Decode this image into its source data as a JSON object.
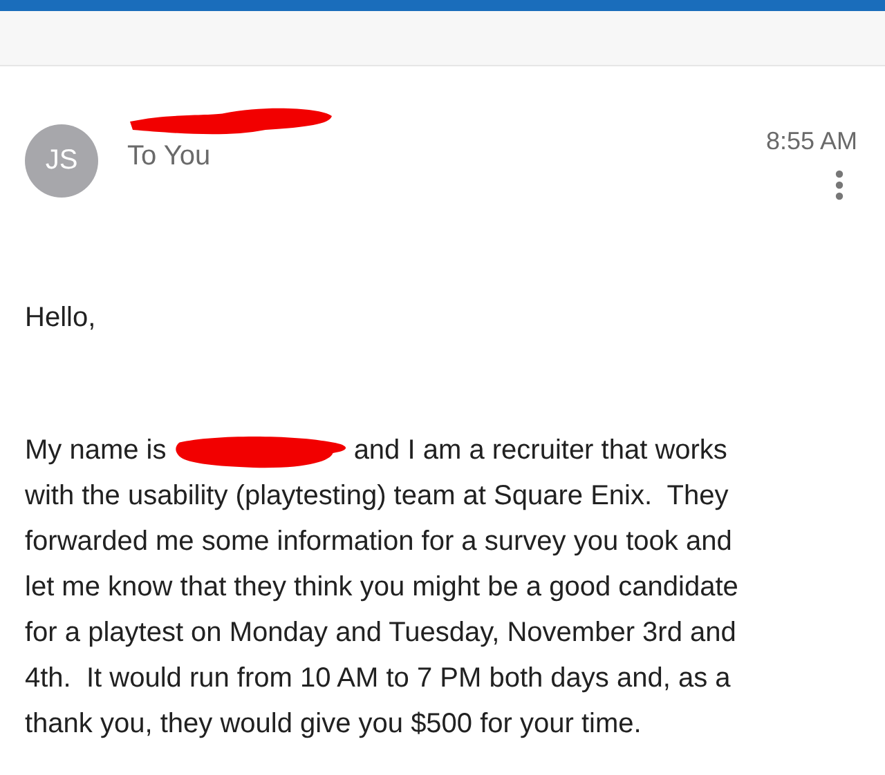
{
  "message": {
    "avatar_initials": "JS",
    "recipient": "To You",
    "time": "8:55 AM",
    "greeting": "Hello,",
    "body_first": "My name is ",
    "body_rest": "and I am a recruiter that works",
    "body_lines": [
      "with the usability (playtesting) team at Square Enix.  They",
      "forwarded me some information for a survey you took and",
      "let me know that they think you might be a good candidate",
      "for a playtest on Monday and Tuesday, November 3rd and",
      "4th.  It would run from 10 AM to 7 PM both days and, as a",
      "thank you, they would give you $500 for your time."
    ]
  }
}
